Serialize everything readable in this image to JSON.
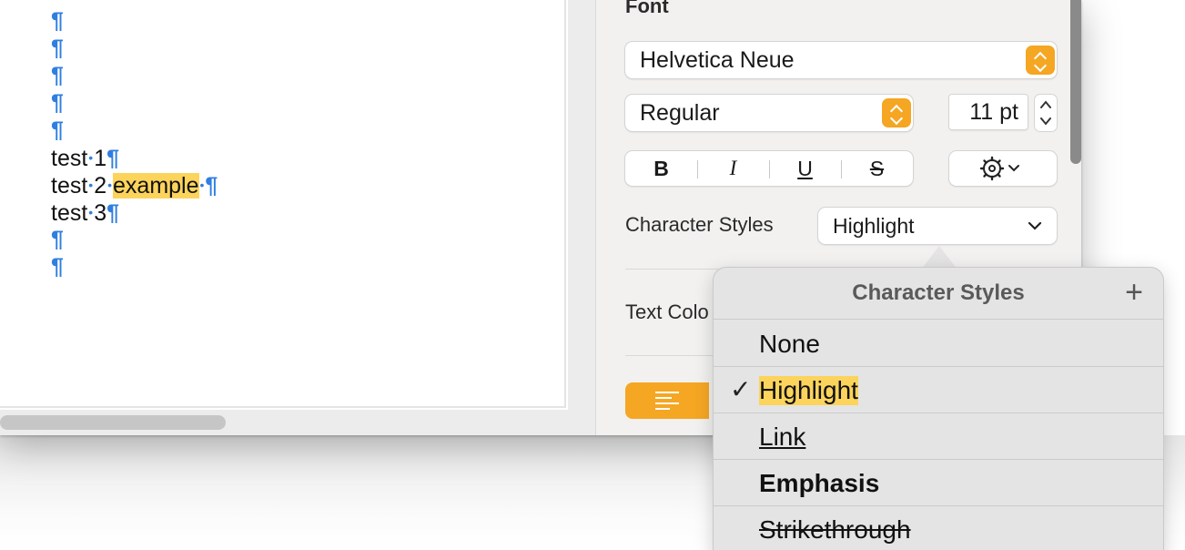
{
  "document": {
    "pilcrow": "¶",
    "dot": "•",
    "lines": [
      {
        "a": "test",
        "b": "1"
      },
      {
        "a": "test",
        "b": "2",
        "c": "example"
      },
      {
        "a": "test",
        "b": "3"
      }
    ]
  },
  "inspector": {
    "font_label": "Font",
    "font_family": "Helvetica Neue",
    "font_typeface": "Regular",
    "font_size": "11 pt",
    "bold": "B",
    "italic": "I",
    "underline": "U",
    "strike": "S",
    "char_styles_label": "Character Styles",
    "char_style_value": "Highlight",
    "text_color_label": "Text Colo"
  },
  "menu": {
    "title": "Character Styles",
    "add": "+",
    "check": "✓",
    "items": [
      "None",
      "Highlight",
      "Link",
      "Emphasis",
      "Strikethrough"
    ]
  },
  "colors": {
    "accent": "#f5a623",
    "highlight": "#fcd45c",
    "invisibles": "#2f7ee0"
  }
}
